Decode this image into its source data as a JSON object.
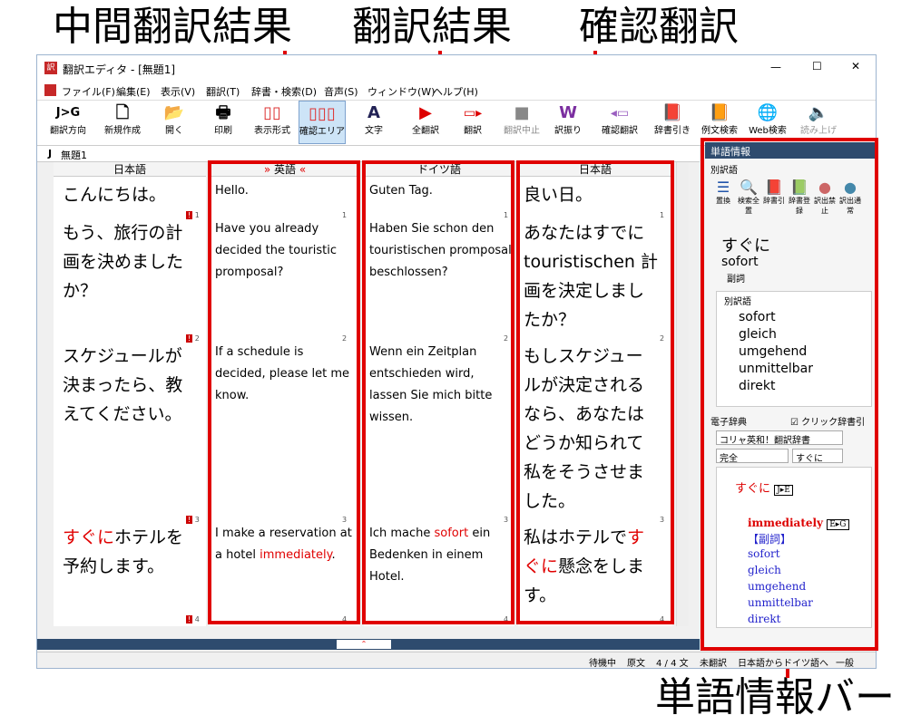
{
  "callouts": {
    "intermediate": "中間翻訳結果",
    "result": "翻訳結果",
    "confirm": "確認翻訳",
    "word_info_bar": "単語情報バー"
  },
  "window": {
    "title": "翻訳エディタ - [無題1]",
    "min": "—",
    "max": "☐",
    "close": "✕"
  },
  "menu": [
    "ファイル(F)",
    "編集(E)",
    "表示(V)",
    "翻訳(T)",
    "辞書・検索(D)",
    "音声(S)",
    "ウィンドウ(W)",
    "ヘルプ(H)"
  ],
  "toolbar": {
    "direction": "翻訳方向",
    "direction_icon": "J>G",
    "new": "新規作成",
    "open": "開く",
    "print": "印刷",
    "display": "表示形式",
    "confirm_area": "確認エリア",
    "font": "文字",
    "translate_all": "全翻訳",
    "translate": "翻訳",
    "stop": "翻訳中止",
    "furigana": "訳振り",
    "confirm_translate": "確認翻訳",
    "dict_lookup": "辞書引き",
    "example_search": "例文検索",
    "web_search": "Web検索",
    "read_aloud": "読み上げ"
  },
  "doc_tab": "無題1",
  "doc_tab_icon": "J",
  "panes": {
    "source_header": "日本語",
    "inter_header": "英語",
    "result_header": "ドイツ語",
    "confirm_header": "日本語"
  },
  "source": {
    "s1": "こんにちは。",
    "s2": "もう、旅行の計画を決めましたか？",
    "s3": "スケジュールが決まったら、教えてください。",
    "s4_red": "すぐに",
    "s4_rest": "ホテルを予約します。"
  },
  "inter": {
    "s1": "Hello.",
    "s2": "Have you already decided the touristic promposal?",
    "s3": "If a schedule is decided, please let me know.",
    "s4a": "I make a reservation at a hotel",
    "s4_red": "immediately",
    "s4b": "."
  },
  "result": {
    "s1": "Guten Tag.",
    "s2": "Haben Sie schon den touristischen promposal beschlossen?",
    "s3": "Wenn ein Zeitplan entschieden wird, lassen Sie mich bitte wissen.",
    "s4a": "Ich mache ",
    "s4_red": "sofort",
    "s4b": " ein Bedenken in einem Hotel."
  },
  "confirm": {
    "s1": "良い日。",
    "s2": "あなたはすでにtouristischen 計画を決定しましたか？",
    "s3": "もしスケジュールが決定されるなら、あなたはどうか知られて私をそうさせました。",
    "s4a": "私はホテルで",
    "s4_red": "すぐに",
    "s4b": "懸念をします。"
  },
  "nums": [
    "1",
    "2",
    "3",
    "4"
  ],
  "word_panel": {
    "title": "単語情報",
    "alt_section": "別訳語",
    "btns": [
      "置換",
      "検索全置",
      "辞書引",
      "辞書登録",
      "訳出禁止",
      "訳出通常"
    ],
    "headword": "すぐに",
    "translation": "sofort",
    "pos": "副詞",
    "alt_header": "別訳語",
    "alt_list": [
      "sofort",
      "gleich",
      "umgehend",
      "unmittelbar",
      "direkt"
    ],
    "dict_title": "電子辞典",
    "click_lookup": "クリック辞書引",
    "dict_select": "コリャ英和！翻訳辞書",
    "match_select": "完全",
    "search_value": "すぐに",
    "dict_headword": "すぐに",
    "dict_badge1": "J▸E",
    "dict_entry": "immediately",
    "dict_badge2": "E▸G",
    "dict_pos": "【副詞】",
    "dict_words": [
      "sofort",
      "gleich",
      "umgehend",
      "unmittelbar",
      "direkt"
    ]
  },
  "status": {
    "state": "待機中",
    "original": "原文",
    "count": "4 / 4 文",
    "untranslated": "未翻訳",
    "direction": "日本語からドイツ語へ",
    "category": "一般"
  }
}
